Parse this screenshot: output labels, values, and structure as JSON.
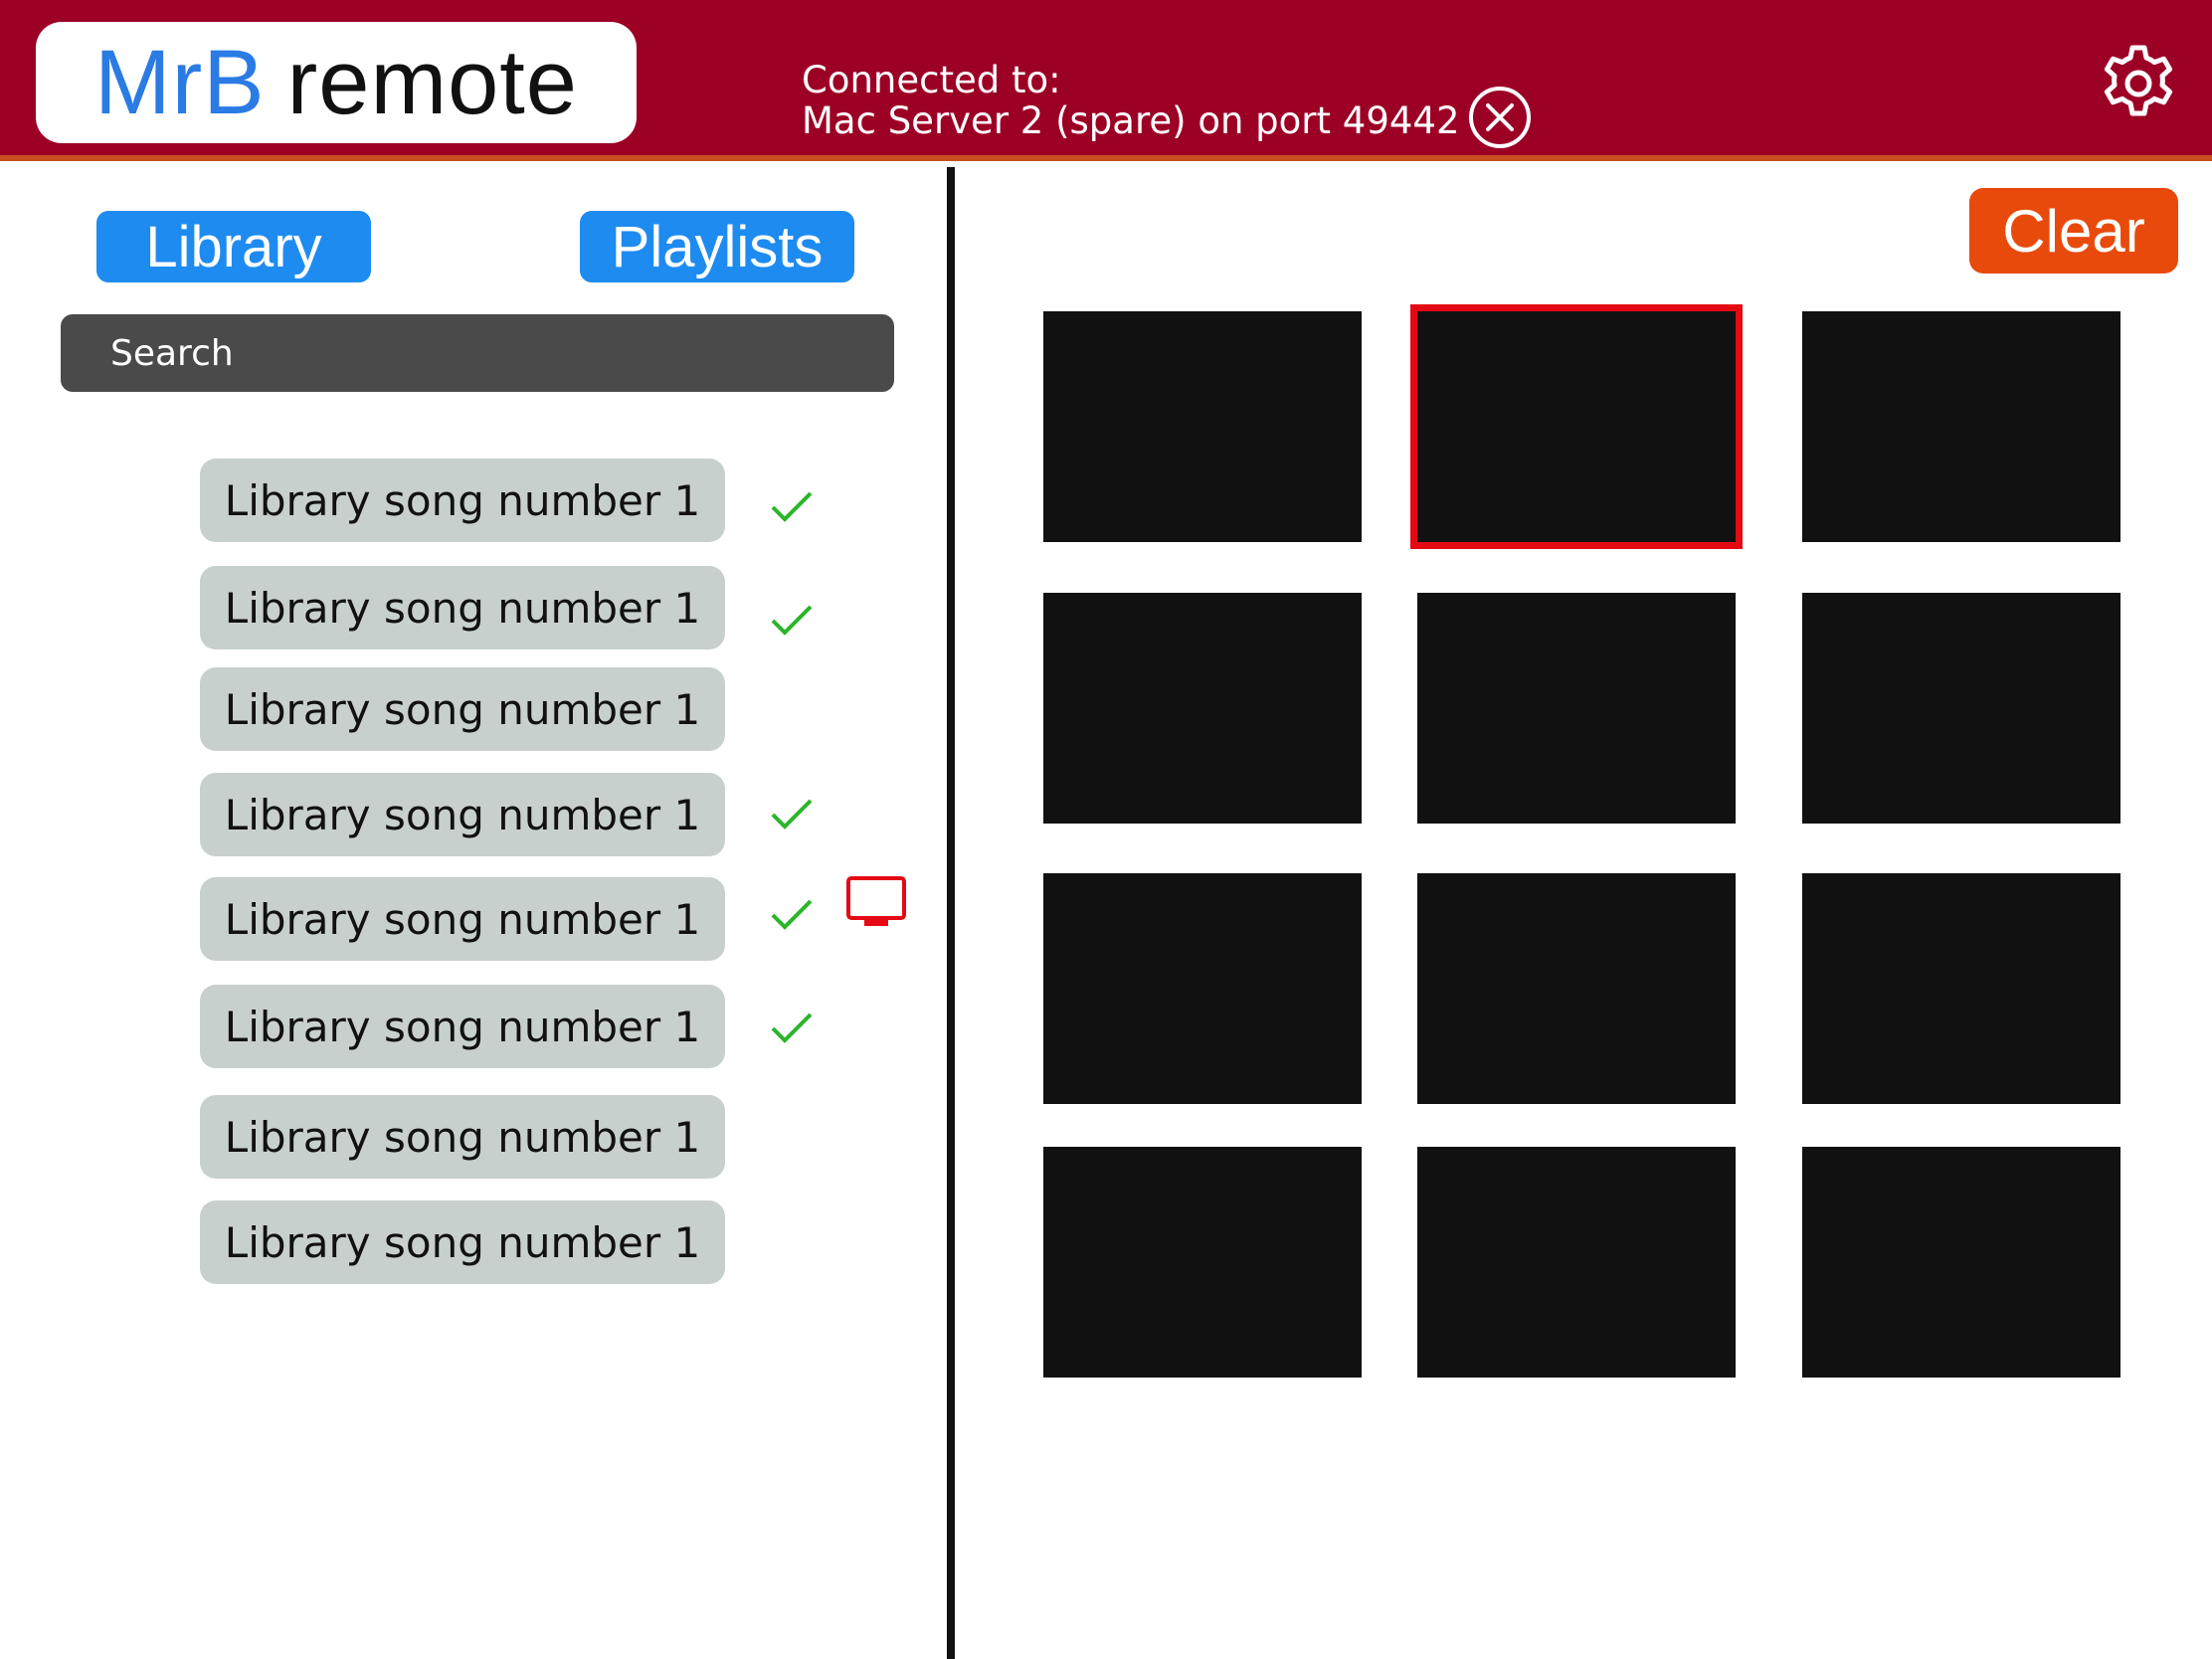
{
  "app": {
    "logo_brand": "MrB",
    "logo_rest": "remote"
  },
  "connection": {
    "label": "Connected to:",
    "value": "Mac Server 2 (spare) on port 49442"
  },
  "icons": {
    "disconnect": "close-circle-icon",
    "settings": "gear-icon",
    "check": "check-icon",
    "monitor": "monitor-icon"
  },
  "tabs": {
    "library": "Library",
    "playlists": "Playlists"
  },
  "search": {
    "placeholder": "Search"
  },
  "songs": [
    {
      "label": "Library song number 1",
      "checked": true
    },
    {
      "label": "Library song number 1",
      "checked": true
    },
    {
      "label": "Library song number 1",
      "checked": false
    },
    {
      "label": "Library song number 1",
      "checked": true
    },
    {
      "label": "Library song number 1",
      "checked": true,
      "on_screen": true
    },
    {
      "label": "Library song number 1",
      "checked": true
    },
    {
      "label": "Library song number 1",
      "checked": false
    },
    {
      "label": "Library song number 1",
      "checked": false
    }
  ],
  "actions": {
    "clear": "Clear"
  },
  "grid": {
    "rows": 4,
    "columns": 3,
    "selected_tile": 2
  },
  "colors": {
    "header": "#9c0025",
    "accent_blue": "#1e8bf0",
    "clear_orange": "#e84a0c",
    "check_green": "#2bb52b",
    "selected_red": "#e50914"
  }
}
